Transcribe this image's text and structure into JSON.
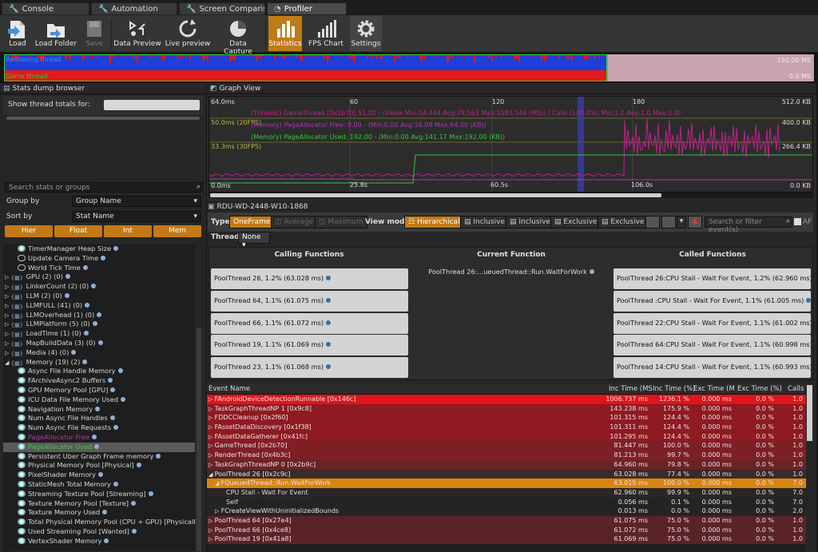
{
  "tabs": [
    {
      "label": "Console"
    },
    {
      "label": "Automation"
    },
    {
      "label": "Screen Comparison"
    },
    {
      "label": "Profiler"
    }
  ],
  "toolbar": {
    "load": "Load",
    "load_folder": "Load Folder",
    "save": "Save",
    "data_preview": "Data Preview",
    "live_preview": "Live preview",
    "data_capture": "Data Capture",
    "statistics": "Statistics",
    "fps_chart": "FPS Chart",
    "settings": "Settings"
  },
  "overview": {
    "rendering_thread": "Rendering thread",
    "game_thread": "Game thread",
    "max_label": "150.00 MS",
    "min_label": "0.0 MS"
  },
  "stats_browser": {
    "title": "Stats dump browser",
    "show_thread_totals": "Show thread totals for:",
    "search_placeholder": "Search stats or groups",
    "group_by_label": "Group by",
    "group_by_value": "Group Name",
    "sort_by_label": "Sort by",
    "sort_by_value": "Stat Name",
    "filters": [
      "Hier",
      "Float",
      "Int",
      "Mem"
    ]
  },
  "tree": [
    {
      "label": "TimerManager Heap Size",
      "indent": 1,
      "kind": "mem"
    },
    {
      "label": "Update Camera Time",
      "indent": 1,
      "kind": "cyc"
    },
    {
      "label": "World Tick Time",
      "indent": 1,
      "kind": "cyc"
    },
    {
      "label": "GPU (2) (0)",
      "indent": 0,
      "kind": "grp"
    },
    {
      "label": "LinkerCount (2) (0)",
      "indent": 0,
      "kind": "grp"
    },
    {
      "label": "LLM (2) (0)",
      "indent": 0,
      "kind": "grp"
    },
    {
      "label": "LLMFULL (41) (0)",
      "indent": 0,
      "kind": "grp"
    },
    {
      "label": "LLMOverhead (1) (0)",
      "indent": 0,
      "kind": "grp"
    },
    {
      "label": "LLMPlatform (5) (0)",
      "indent": 0,
      "kind": "grp"
    },
    {
      "label": "LoadTime (1) (0)",
      "indent": 0,
      "kind": "grp"
    },
    {
      "label": "MapBuildData (3) (0)",
      "indent": 0,
      "kind": "grp"
    },
    {
      "label": "Media (4) (0)",
      "indent": 0,
      "kind": "grp"
    },
    {
      "label": "Memory (19) (2)",
      "indent": 0,
      "kind": "grp-open"
    },
    {
      "label": "Async File Handle Memory",
      "indent": 1,
      "kind": "mem"
    },
    {
      "label": "FArchiveAsync2 Buffers",
      "indent": 1,
      "kind": "mem"
    },
    {
      "label": "GPU Memory Pool [GPU]",
      "indent": 1,
      "kind": "mem"
    },
    {
      "label": "ICU Data File Memory Used",
      "indent": 1,
      "kind": "mem"
    },
    {
      "label": "Navigation Memory",
      "indent": 1,
      "kind": "mem"
    },
    {
      "label": "Num Async File Handles",
      "indent": 1,
      "kind": "mem"
    },
    {
      "label": "Num Async File Requests",
      "indent": 1,
      "kind": "mem"
    },
    {
      "label": "PageAllocator Free",
      "indent": 1,
      "kind": "mem",
      "color": "#b236b2"
    },
    {
      "label": "PageAllocator Used",
      "indent": 1,
      "kind": "mem",
      "color": "#45c43c",
      "selected": true
    },
    {
      "label": "Persistent Uber Graph Frame memory",
      "indent": 1,
      "kind": "mem"
    },
    {
      "label": "Physical Memory Pool [Physical]",
      "indent": 1,
      "kind": "mem"
    },
    {
      "label": "PixelShader Memory",
      "indent": 1,
      "kind": "mem"
    },
    {
      "label": "StaticMesh Total Memory",
      "indent": 1,
      "kind": "mem"
    },
    {
      "label": "Streaming Texture Pool [Streaming]",
      "indent": 1,
      "kind": "mem"
    },
    {
      "label": "Texture Memory Pool [Texture]",
      "indent": 1,
      "kind": "mem"
    },
    {
      "label": "Texture Memory Used",
      "indent": 1,
      "kind": "mem"
    },
    {
      "label": "Total Physical Memory Pool (CPU + GPU) [PhysicalLLM",
      "indent": 1,
      "kind": "mem"
    },
    {
      "label": "Used Streaming Pool [Wanted]",
      "indent": 1,
      "kind": "mem"
    },
    {
      "label": "VertexShader Memory",
      "indent": 1,
      "kind": "mem"
    }
  ],
  "graph_view": {
    "title": "Graph View",
    "y_top_left": "64.0ms",
    "y_50": "50.0ms (20FPS)",
    "y_33": "33.3ms (30FPS)",
    "y_0": "0.0ms",
    "x_ticks": [
      "60",
      "120",
      "180"
    ],
    "t_ticks": [
      "25.8s",
      "60.5s",
      "106.0s"
    ],
    "y_right": [
      "512.0 KB",
      "400.0 KB",
      "266.4 KB",
      "0.0 KB"
    ],
    "legend": [
      {
        "text": "(Threads) GameThread [0x2b70] 51.02 - (Value Min:14.444 Avg:79.563 Max:1083.146 (MS)) / Calls (100.0%) Min:1.0 Avg:1.0 Max:1.0)",
        "color": "#c0208a"
      },
      {
        "text": "(Memory) PageAllocator Free: 0.00 - (Min:0.00 Avg:16.09 Max:64.00 (KB))",
        "color": "#9a2ca0"
      },
      {
        "text": "(Memory) PageAllocator Used: 192.00 - (Min:0.00 Avg:141.17 Max:192.00 (KB))",
        "color": "#3bc23b"
      }
    ]
  },
  "profiler": {
    "session": "RDU-WD-2448-W10-1868",
    "type_label": "Type",
    "type_buttons": [
      "OneFrame",
      "Average",
      "Maximum"
    ],
    "view_mode_label": "View mode",
    "view_buttons": [
      "Hierarchical",
      "Inclusive",
      "Inclusive",
      "Exclusive",
      "Exclusive"
    ],
    "filter_placeholder": "Search or filter event(s)",
    "af_label": "AF",
    "thread_label": "Thread",
    "thread_value": "None"
  },
  "functions": {
    "calling_header": "Calling Functions",
    "current_header": "Current Function",
    "called_header": "Called Functions",
    "current": "PoolThread 26:...ueuedThread::Run.WaitForWork",
    "calling": [
      "PoolThread 26, 1.2% (63.028 ms)",
      "PoolThread 64, 1.1% (61.075 ms)",
      "PoolThread 66, 1.1% (61.072 ms)",
      "PoolThread 19, 1.1% (61.069 ms)",
      "PoolThread 23, 1.1% (61.068 ms)"
    ],
    "called": [
      "PoolThread 26:CPU Stall - Wait For Event, 1.2% (62.960 ms)",
      "PoolThread :CPU Stall - Wait For Event, 1.1% (61.005 ms)",
      "PoolThread 22:CPU Stall - Wait For Event, 1.1% (61.002 ms)",
      "PoolThread 64:CPU Stall - Wait For Event, 1.1% (60.998 ms)",
      "PoolThread 14:CPU Stall - Wait For Event, 1.1% (60.993 ms)"
    ]
  },
  "events": {
    "columns": [
      "Event Name",
      "Inc Time (MS",
      "Inc Time (%)",
      "Exc Time (M",
      "Exc Time (%)",
      "Calls"
    ],
    "rows": [
      {
        "name": "FAndroidDeviceDetectionRunnable [0x146c]",
        "inc": "1006.737 ms",
        "incp": "1236.1 %",
        "exc": "0.000 ms",
        "excp": "0.0 %",
        "calls": "1.0",
        "level": 0,
        "bg": "#e0141c",
        "arrow": "▷"
      },
      {
        "name": "TaskGraphThreadNP 1 [0x9c8]",
        "inc": "143.238 ms",
        "incp": "175.9 %",
        "exc": "0.000 ms",
        "excp": "0.0 %",
        "calls": "1.0",
        "level": 0,
        "bg": "#8e1a22",
        "arrow": "▷"
      },
      {
        "name": "FDDCCleanup [0x2f60]",
        "inc": "101.315 ms",
        "incp": "124.4 %",
        "exc": "0.000 ms",
        "excp": "0.0 %",
        "calls": "1.0",
        "level": 0,
        "bg": "#8e1a22",
        "arrow": "▷"
      },
      {
        "name": "FAssetDataDiscovery [0x1f38]",
        "inc": "101.311 ms",
        "incp": "124.4 %",
        "exc": "0.000 ms",
        "excp": "0.0 %",
        "calls": "1.0",
        "level": 0,
        "bg": "#8e1a22",
        "arrow": "▷"
      },
      {
        "name": "FAssetDataGatherer [0x41fc]",
        "inc": "101.295 ms",
        "incp": "124.4 %",
        "exc": "0.000 ms",
        "excp": "0.0 %",
        "calls": "1.0",
        "level": 0,
        "bg": "#8e1a22",
        "arrow": "▷"
      },
      {
        "name": "GameThread [0x2b70]",
        "inc": "81.447 ms",
        "incp": "100.0 %",
        "exc": "0.000 ms",
        "excp": "0.0 %",
        "calls": "1.0",
        "level": 0,
        "bg": "#7e1f26",
        "arrow": "▷"
      },
      {
        "name": "RenderThread [0x4b3c]",
        "inc": "81.213 ms",
        "incp": "99.7 %",
        "exc": "0.000 ms",
        "excp": "0.0 %",
        "calls": "1.0",
        "level": 0,
        "bg": "#7e1f26",
        "arrow": "▷"
      },
      {
        "name": "TaskGraphThreadNP 0 [0x2b9c]",
        "inc": "64.960 ms",
        "incp": "79.8 %",
        "exc": "0.000 ms",
        "excp": "0.0 %",
        "calls": "1.0",
        "level": 0,
        "bg": "#6a2228",
        "arrow": "▷"
      },
      {
        "name": "PoolThread 26 [0x2c9c]",
        "inc": "63.028 ms",
        "incp": "77.4 %",
        "exc": "0.000 ms",
        "excp": "0.0 %",
        "calls": "1.0",
        "level": 0,
        "bg": "#3a2a2a",
        "arrow": "◢"
      },
      {
        "name": "FQueuedThread::Run.WaitForWork",
        "inc": "63.015 ms",
        "incp": "100.0 %",
        "exc": "0.000 ms",
        "excp": "0.0 %",
        "calls": "7.0",
        "level": 1,
        "bg": "#d8850f",
        "arrow": "◢"
      },
      {
        "name": "CPU Stall - Wait For Event",
        "inc": "62.960 ms",
        "incp": "99.9 %",
        "exc": "0.000 ms",
        "excp": "0.0 %",
        "calls": "7.0",
        "level": 2,
        "bg": "#2a2626",
        "arrow": ""
      },
      {
        "name": "Self",
        "inc": "0.056 ms",
        "incp": "0.1 %",
        "exc": "0.000 ms",
        "excp": "0.0 %",
        "calls": "7.0",
        "level": 2,
        "bg": "#242424",
        "arrow": ""
      },
      {
        "name": "FCreateViewWithUninitializedBounds",
        "inc": "0.013 ms",
        "incp": "0.0 %",
        "exc": "0.000 ms",
        "excp": "0.0 %",
        "calls": "2.0",
        "level": 1,
        "bg": "#242424",
        "arrow": "▷"
      },
      {
        "name": "PoolThread 64 [0x27e4]",
        "inc": "61.075 ms",
        "incp": "75.0 %",
        "exc": "0.000 ms",
        "excp": "0.0 %",
        "calls": "1.0",
        "level": 0,
        "bg": "#5a2328",
        "arrow": "▷"
      },
      {
        "name": "PoolThread 66 [0x4ce8]",
        "inc": "61.072 ms",
        "incp": "75.0 %",
        "exc": "0.000 ms",
        "excp": "0.0 %",
        "calls": "1.0",
        "level": 0,
        "bg": "#5a2328",
        "arrow": "▷"
      },
      {
        "name": "PoolThread 19 [0x41a8]",
        "inc": "61.069 ms",
        "incp": "75.0 %",
        "exc": "0.000 ms",
        "excp": "0.0 %",
        "calls": "1.0",
        "level": 0,
        "bg": "#5a2328",
        "arrow": "▷"
      }
    ]
  }
}
